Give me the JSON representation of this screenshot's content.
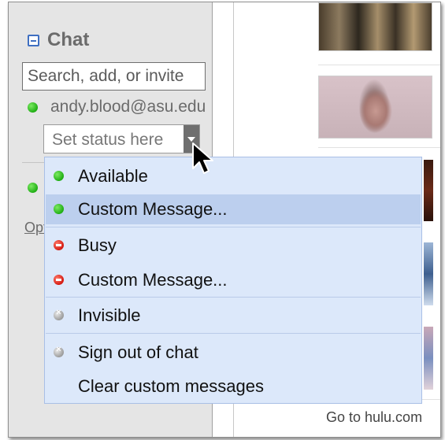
{
  "chat": {
    "title": "Chat",
    "search_placeholder": "Search, add, or invite",
    "user_email": "andy.blood@asu.edu",
    "status_placeholder": "Set status here",
    "options_link": "Options"
  },
  "status_menu": {
    "items": [
      {
        "label": "Available",
        "icon": "green-dot-icon"
      },
      {
        "label": "Custom Message...",
        "icon": "green-dot-icon",
        "highlighted": true
      },
      {
        "label": "Busy",
        "icon": "red-dot-icon"
      },
      {
        "label": "Custom Message...",
        "icon": "red-dot-icon"
      },
      {
        "label": "Invisible",
        "icon": "gray-dot-icon"
      },
      {
        "label": "Sign out of chat",
        "icon": "gray-dot-icon"
      },
      {
        "label": "Clear custom messages",
        "icon": ""
      }
    ]
  },
  "right_panel": {
    "footer_link": "Go to hulu.com"
  },
  "colors": {
    "menu_bg": "#dce8fa",
    "menu_highlight": "#bccfee",
    "available": "#1fae14",
    "busy": "#d41a12",
    "invisible": "#9c9c9c",
    "accent": "#3f6fc1"
  }
}
